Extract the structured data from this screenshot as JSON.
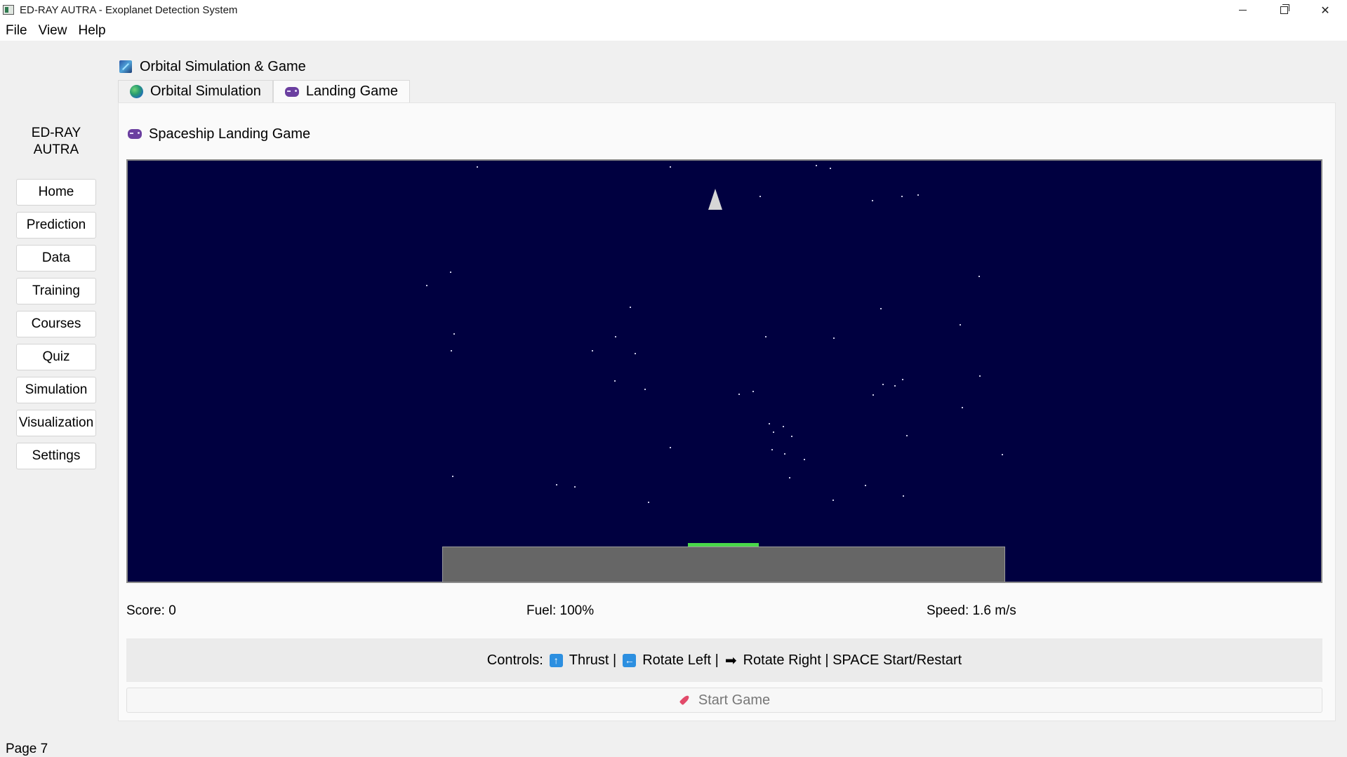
{
  "window": {
    "title": "ED-RAY AUTRA - Exoplanet Detection System",
    "controls": [
      "minimize-icon",
      "maximize-icon",
      "close-icon"
    ]
  },
  "menubar": {
    "items": [
      "File",
      "View",
      "Help"
    ]
  },
  "sidebar": {
    "brand_line1": "ED-RAY",
    "brand_line2": "AUTRA",
    "items": [
      "Home",
      "Prediction",
      "Data",
      "Training",
      "Courses",
      "Quiz",
      "Simulation",
      "Visualization",
      "Settings"
    ]
  },
  "group": {
    "title": "Orbital Simulation & Game",
    "icon": "orbit-icon"
  },
  "tabs": [
    {
      "label": "Orbital Simulation",
      "icon": "globe-icon"
    },
    {
      "label": "Landing Game",
      "icon": "gamepad-icon",
      "active": true
    }
  ],
  "game": {
    "title": "Spaceship Landing Game",
    "icon": "gamepad-icon",
    "colors": {
      "space": "#000040",
      "ground": "#666666",
      "landing_pad": "#4ad84a",
      "ship": "#d6d6d6"
    }
  },
  "stats": {
    "score": "Score: 0",
    "fuel": "Fuel: 100%",
    "speed": "Speed: 1.6 m/s"
  },
  "controls": {
    "label": "Controls:",
    "thrust": "Thrust |",
    "rotate_left": "Rotate Left |",
    "rotate_right": "Rotate Right | SPACE Start/Restart"
  },
  "start_button": {
    "label": "Start Game",
    "icon": "rocket-icon"
  },
  "status": {
    "page": "Page 7"
  }
}
